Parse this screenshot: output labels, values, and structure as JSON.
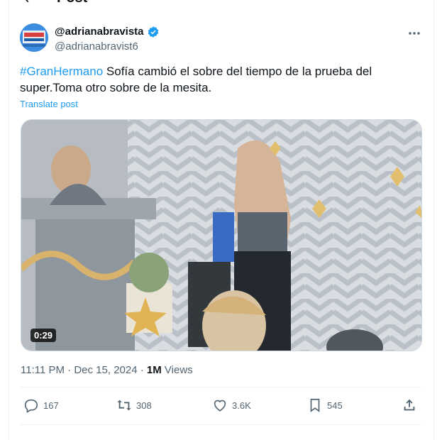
{
  "page": {
    "title": "Post"
  },
  "author": {
    "display_name": "@adrianabravista",
    "handle": "@adrianabravist6",
    "verified": true
  },
  "post": {
    "hashtag": "#GranHermano",
    "text": " Sofía cambió el sobre del tiempo de la prueba del super.Toma otro sobre de la mesita.",
    "translate_label": "Translate post",
    "video_duration": "0:29"
  },
  "meta": {
    "time": "11:11 PM",
    "separator": "·",
    "date": "Dec 15, 2024",
    "views_count": "1M",
    "views_label": "Views"
  },
  "actions": {
    "replies": "167",
    "reposts": "308",
    "likes": "3.6K",
    "bookmarks": "545"
  },
  "colors": {
    "accent": "#1d9bf0",
    "secondary_text": "#536471",
    "text": "#0f1419"
  },
  "icons": [
    "back-arrow-icon",
    "verified-badge-icon",
    "more-icon",
    "reply-icon",
    "repost-icon",
    "like-icon",
    "bookmark-icon",
    "share-icon"
  ]
}
